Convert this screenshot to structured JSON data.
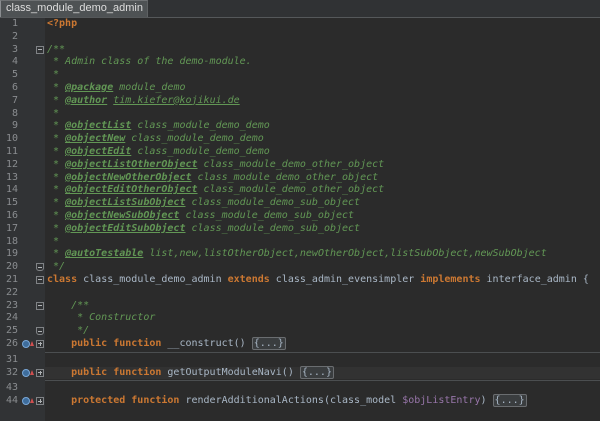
{
  "tab": {
    "label": "class_module_demo_admin"
  },
  "colors": {
    "editor_bg": "#2B2B2B",
    "gutter_bg": "#313335",
    "line_number": "#8A8D90",
    "keyword": "#CC7832",
    "plain": "#A9B7C6",
    "doc_comment": "#629755",
    "doc_tag": "#629755",
    "variable": "#9876AA",
    "caret_line": "#323232",
    "tab_bg": "#4E5254",
    "tab_text": "#DDDDDD",
    "separator": "#4B4E50"
  },
  "lines": [
    {
      "n": "1",
      "tokens": [
        {
          "t": "<?php",
          "c": "php"
        }
      ]
    },
    {
      "n": "2",
      "tokens": []
    },
    {
      "n": "3",
      "fold": "fold-open-icon",
      "tokens": [
        {
          "t": "/**",
          "c": "doc"
        }
      ]
    },
    {
      "n": "4",
      "tokens": [
        {
          "t": " * Admin class of the demo-module.",
          "c": "doc"
        }
      ]
    },
    {
      "n": "5",
      "tokens": [
        {
          "t": " *",
          "c": "doc"
        }
      ]
    },
    {
      "n": "6",
      "tokens": [
        {
          "t": " * ",
          "c": "doc"
        },
        {
          "t": "@package",
          "c": "tag"
        },
        {
          "t": " module_demo",
          "c": "doc"
        }
      ]
    },
    {
      "n": "7",
      "tokens": [
        {
          "t": " * ",
          "c": "doc"
        },
        {
          "t": "@author",
          "c": "tag"
        },
        {
          "t": "tim.kiefer@kojikui.de",
          "c": "link"
        }
      ]
    },
    {
      "n": "8",
      "tokens": [
        {
          "t": " *",
          "c": "doc"
        }
      ]
    },
    {
      "n": "9",
      "tokens": [
        {
          "t": " * ",
          "c": "doc"
        },
        {
          "t": "@objectList",
          "c": "tag"
        },
        {
          "t": " class_module_demo_demo",
          "c": "doc"
        }
      ]
    },
    {
      "n": "10",
      "tokens": [
        {
          "t": " * ",
          "c": "doc"
        },
        {
          "t": "@objectNew",
          "c": "tag"
        },
        {
          "t": " class_module_demo_demo",
          "c": "doc"
        }
      ]
    },
    {
      "n": "11",
      "tokens": [
        {
          "t": " * ",
          "c": "doc"
        },
        {
          "t": "@objectEdit",
          "c": "tag"
        },
        {
          "t": " class_module_demo_demo",
          "c": "doc"
        }
      ]
    },
    {
      "n": "12",
      "tokens": [
        {
          "t": " * ",
          "c": "doc"
        },
        {
          "t": "@objectListOtherObject",
          "c": "tag"
        },
        {
          "t": " class_module_demo_other_object",
          "c": "doc"
        }
      ]
    },
    {
      "n": "13",
      "tokens": [
        {
          "t": " * ",
          "c": "doc"
        },
        {
          "t": "@objectNewOtherObject",
          "c": "tag"
        },
        {
          "t": " class_module_demo_other_object",
          "c": "doc"
        }
      ]
    },
    {
      "n": "14",
      "tokens": [
        {
          "t": " * ",
          "c": "doc"
        },
        {
          "t": "@objectEditOtherObject",
          "c": "tag"
        },
        {
          "t": " class_module_demo_other_object",
          "c": "doc"
        }
      ]
    },
    {
      "n": "15",
      "tokens": [
        {
          "t": " * ",
          "c": "doc"
        },
        {
          "t": "@objectListSubObject",
          "c": "tag"
        },
        {
          "t": " class_module_demo_sub_object",
          "c": "doc"
        }
      ]
    },
    {
      "n": "16",
      "tokens": [
        {
          "t": " * ",
          "c": "doc"
        },
        {
          "t": "@objectNewSubObject",
          "c": "tag"
        },
        {
          "t": " class_module_demo_sub_object",
          "c": "doc"
        }
      ]
    },
    {
      "n": "17",
      "tokens": [
        {
          "t": " * ",
          "c": "doc"
        },
        {
          "t": "@objectEditSubObject",
          "c": "tag"
        },
        {
          "t": " class_module_demo_sub_object",
          "c": "doc"
        }
      ]
    },
    {
      "n": "18",
      "tokens": [
        {
          "t": " *",
          "c": "doc"
        }
      ]
    },
    {
      "n": "19",
      "tokens": [
        {
          "t": " * ",
          "c": "doc"
        },
        {
          "t": "@autoTestable",
          "c": "tag"
        },
        {
          "t": " list,new,listOtherObject,newOtherObject,listSubObject,newSubObject",
          "c": "doc"
        }
      ]
    },
    {
      "n": "20",
      "fold": "fold-close-icon",
      "tokens": [
        {
          "t": " */",
          "c": "doc"
        }
      ]
    },
    {
      "n": "21",
      "fold": "fold-open-icon",
      "tokens": [
        {
          "t": "class",
          "c": "kw"
        },
        {
          "t": " class_module_demo_admin ",
          "c": "plain"
        },
        {
          "t": "extends",
          "c": "kw"
        },
        {
          "t": " class_admin_evensimpler ",
          "c": "plain"
        },
        {
          "t": "implements",
          "c": "kw"
        },
        {
          "t": " interface_admin {",
          "c": "plain"
        }
      ]
    },
    {
      "n": "22",
      "tokens": []
    },
    {
      "n": "23",
      "fold": "fold-open-icon",
      "tokens": [
        {
          "t": "    /**",
          "c": "doc"
        }
      ]
    },
    {
      "n": "24",
      "tokens": [
        {
          "t": "     * Constructor",
          "c": "doc"
        }
      ]
    },
    {
      "n": "25",
      "fold": "fold-close-icon",
      "tokens": [
        {
          "t": "     */",
          "c": "doc"
        }
      ]
    },
    {
      "n": "26",
      "marker": "override-method-icon",
      "fold": "fold-collapsed-icon",
      "tokens": [
        {
          "t": "    public function",
          "c": "kw"
        },
        {
          "t": " __construct() ",
          "c": "plain"
        },
        {
          "t": "{...}",
          "c": "folded"
        }
      ]
    },
    {
      "n": "31",
      "separator_above": true,
      "tokens": []
    },
    {
      "n": "32",
      "caret_line": true,
      "marker": "override-method-icon",
      "fold": "fold-collapsed-icon",
      "tokens": [
        {
          "t": "    public function",
          "c": "kw"
        },
        {
          "t": " getOutputModuleNavi() ",
          "c": "plain"
        },
        {
          "t": "{...}",
          "c": "folded"
        }
      ]
    },
    {
      "n": "43",
      "separator_above": true,
      "tokens": []
    },
    {
      "n": "44",
      "marker": "override-method-icon",
      "fold": "fold-collapsed-icon",
      "tokens": [
        {
          "t": "    protected function",
          "c": "kw"
        },
        {
          "t": " renderAdditionalActions(class_model ",
          "c": "plain"
        },
        {
          "t": "$objListEntry",
          "c": "var"
        },
        {
          "t": ") ",
          "c": "plain"
        },
        {
          "t": "{...}",
          "c": "folded"
        }
      ]
    }
  ]
}
